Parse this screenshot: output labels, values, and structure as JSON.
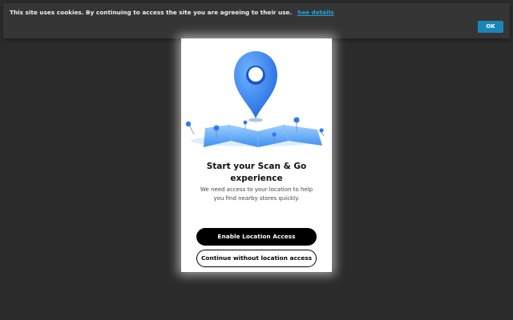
{
  "cookie_banner": {
    "message": "This site uses cookies. By continuing to access the site you are agreeing to their use.",
    "link_label": "See details",
    "ok_label": "OK"
  },
  "dialog": {
    "title": "Start your Scan & Go experience",
    "description": "We need access to your location to help you find nearby stores quickly.",
    "enable_button_label": "Enable Location Access",
    "skip_button_label": "Continue without location access",
    "illustration_icon": "map-location-pin-icon"
  },
  "colors": {
    "background": "#2b2b2b",
    "banner": "#353535",
    "link": "#1fa3e0",
    "ok_button": "#1a86b8",
    "pin_blue": "#2b7cf0"
  }
}
